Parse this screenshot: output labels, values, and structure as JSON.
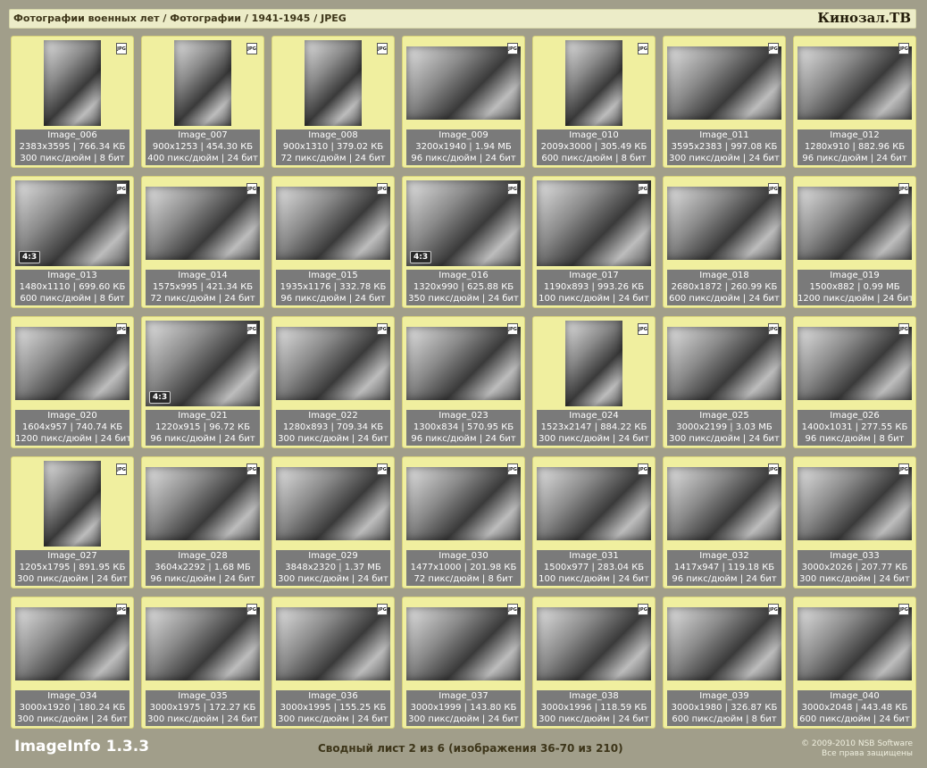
{
  "header": {
    "breadcrumb": "Фотографии военных лет / Фотографии / 1941-1945 / JPEG",
    "brand": "Кинозал.ТВ"
  },
  "footer": {
    "app_name": "ImageInfo 1.3.3",
    "sheet_info": "Сводный лист 2 из 6 (изображения 36-70 из 210)",
    "copyright_line1": "© 2009-2010 NSB Software",
    "copyright_line2": "Все права защищены"
  },
  "badge_label": "JPG",
  "images": [
    {
      "name": "Image_006",
      "dims": "2383x3595 | 766.34 КБ",
      "res": "300 пикс/дюйм | 8 бит",
      "orient": "portrait",
      "ratio": ""
    },
    {
      "name": "Image_007",
      "dims": "900x1253 | 454.30 КБ",
      "res": "400 пикс/дюйм | 24 бит",
      "orient": "portrait",
      "ratio": ""
    },
    {
      "name": "Image_008",
      "dims": "900x1310 | 379.02 КБ",
      "res": "72 пикс/дюйм | 24 бит",
      "orient": "portrait",
      "ratio": ""
    },
    {
      "name": "Image_009",
      "dims": "3200x1940 | 1.94 МБ",
      "res": "96 пикс/дюйм | 24 бит",
      "orient": "landscape",
      "ratio": ""
    },
    {
      "name": "Image_010",
      "dims": "2009x3000 | 305.49 КБ",
      "res": "600 пикс/дюйм | 8 бит",
      "orient": "portrait",
      "ratio": ""
    },
    {
      "name": "Image_011",
      "dims": "3595x2383 | 997.08 КБ",
      "res": "300 пикс/дюйм | 24 бит",
      "orient": "landscape",
      "ratio": ""
    },
    {
      "name": "Image_012",
      "dims": "1280x910 | 882.96 КБ",
      "res": "96 пикс/дюйм | 24 бит",
      "orient": "landscape",
      "ratio": ""
    },
    {
      "name": "Image_013",
      "dims": "1480x1110 | 699.60 КБ",
      "res": "600 пикс/дюйм | 8 бит",
      "orient": "full",
      "ratio": "4:3"
    },
    {
      "name": "Image_014",
      "dims": "1575x995 | 421.34 КБ",
      "res": "72 пикс/дюйм | 24 бит",
      "orient": "landscape",
      "ratio": ""
    },
    {
      "name": "Image_015",
      "dims": "1935x1176 | 332.78 КБ",
      "res": "96 пикс/дюйм | 24 бит",
      "orient": "landscape",
      "ratio": ""
    },
    {
      "name": "Image_016",
      "dims": "1320x990 | 625.88 КБ",
      "res": "350 пикс/дюйм | 24 бит",
      "orient": "full",
      "ratio": "4:3"
    },
    {
      "name": "Image_017",
      "dims": "1190x893 | 993.26 КБ",
      "res": "100 пикс/дюйм | 24 бит",
      "orient": "full",
      "ratio": ""
    },
    {
      "name": "Image_018",
      "dims": "2680x1872 | 260.99 КБ",
      "res": "600 пикс/дюйм | 24 бит",
      "orient": "landscape",
      "ratio": ""
    },
    {
      "name": "Image_019",
      "dims": "1500x882 | 0.99 МБ",
      "res": "1200 пикс/дюйм | 24 бит",
      "orient": "landscape",
      "ratio": ""
    },
    {
      "name": "Image_020",
      "dims": "1604x957 | 740.74 КБ",
      "res": "1200 пикс/дюйм | 24 бит",
      "orient": "landscape",
      "ratio": ""
    },
    {
      "name": "Image_021",
      "dims": "1220x915 | 96.72 КБ",
      "res": "96 пикс/дюйм | 24 бит",
      "orient": "full",
      "ratio": "4:3"
    },
    {
      "name": "Image_022",
      "dims": "1280x893 | 709.34 КБ",
      "res": "300 пикс/дюйм | 24 бит",
      "orient": "landscape",
      "ratio": ""
    },
    {
      "name": "Image_023",
      "dims": "1300x834 | 570.95 КБ",
      "res": "96 пикс/дюйм | 24 бит",
      "orient": "landscape",
      "ratio": ""
    },
    {
      "name": "Image_024",
      "dims": "1523x2147 | 884.22 КБ",
      "res": "300 пикс/дюйм | 24 бит",
      "orient": "portrait",
      "ratio": ""
    },
    {
      "name": "Image_025",
      "dims": "3000x2199 | 3.03 МБ",
      "res": "300 пикс/дюйм | 24 бит",
      "orient": "landscape",
      "ratio": ""
    },
    {
      "name": "Image_026",
      "dims": "1400x1031 | 277.55 КБ",
      "res": "96 пикс/дюйм | 8 бит",
      "orient": "landscape",
      "ratio": ""
    },
    {
      "name": "Image_027",
      "dims": "1205x1795 | 891.95 КБ",
      "res": "300 пикс/дюйм | 24 бит",
      "orient": "portrait",
      "ratio": ""
    },
    {
      "name": "Image_028",
      "dims": "3604x2292 | 1.68 МБ",
      "res": "96 пикс/дюйм | 24 бит",
      "orient": "landscape",
      "ratio": ""
    },
    {
      "name": "Image_029",
      "dims": "3848x2320 | 1.37 МБ",
      "res": "300 пикс/дюйм | 24 бит",
      "orient": "landscape",
      "ratio": ""
    },
    {
      "name": "Image_030",
      "dims": "1477x1000 | 201.98 КБ",
      "res": "72 пикс/дюйм | 8 бит",
      "orient": "landscape",
      "ratio": ""
    },
    {
      "name": "Image_031",
      "dims": "1500x977 | 283.04 КБ",
      "res": "100 пикс/дюйм | 24 бит",
      "orient": "landscape",
      "ratio": ""
    },
    {
      "name": "Image_032",
      "dims": "1417x947 | 119.18 КБ",
      "res": "96 пикс/дюйм | 24 бит",
      "orient": "landscape",
      "ratio": ""
    },
    {
      "name": "Image_033",
      "dims": "3000x2026 | 207.77 КБ",
      "res": "300 пикс/дюйм | 24 бит",
      "orient": "landscape",
      "ratio": ""
    },
    {
      "name": "Image_034",
      "dims": "3000x1920 | 180.24 КБ",
      "res": "300 пикс/дюйм | 24 бит",
      "orient": "landscape",
      "ratio": ""
    },
    {
      "name": "Image_035",
      "dims": "3000x1975 | 172.27 КБ",
      "res": "300 пикс/дюйм | 24 бит",
      "orient": "landscape",
      "ratio": ""
    },
    {
      "name": "Image_036",
      "dims": "3000x1995 | 155.25 КБ",
      "res": "300 пикс/дюйм | 24 бит",
      "orient": "landscape",
      "ratio": ""
    },
    {
      "name": "Image_037",
      "dims": "3000x1999 | 143.80 КБ",
      "res": "300 пикс/дюйм | 24 бит",
      "orient": "landscape",
      "ratio": ""
    },
    {
      "name": "Image_038",
      "dims": "3000x1996 | 118.59 КБ",
      "res": "300 пикс/дюйм | 24 бит",
      "orient": "landscape",
      "ratio": ""
    },
    {
      "name": "Image_039",
      "dims": "3000x1980 | 326.87 КБ",
      "res": "600 пикс/дюйм | 8 бит",
      "orient": "landscape",
      "ratio": ""
    },
    {
      "name": "Image_040",
      "dims": "3000x2048 | 443.48 КБ",
      "res": "600 пикс/дюйм | 24 бит",
      "orient": "landscape",
      "ratio": ""
    }
  ]
}
